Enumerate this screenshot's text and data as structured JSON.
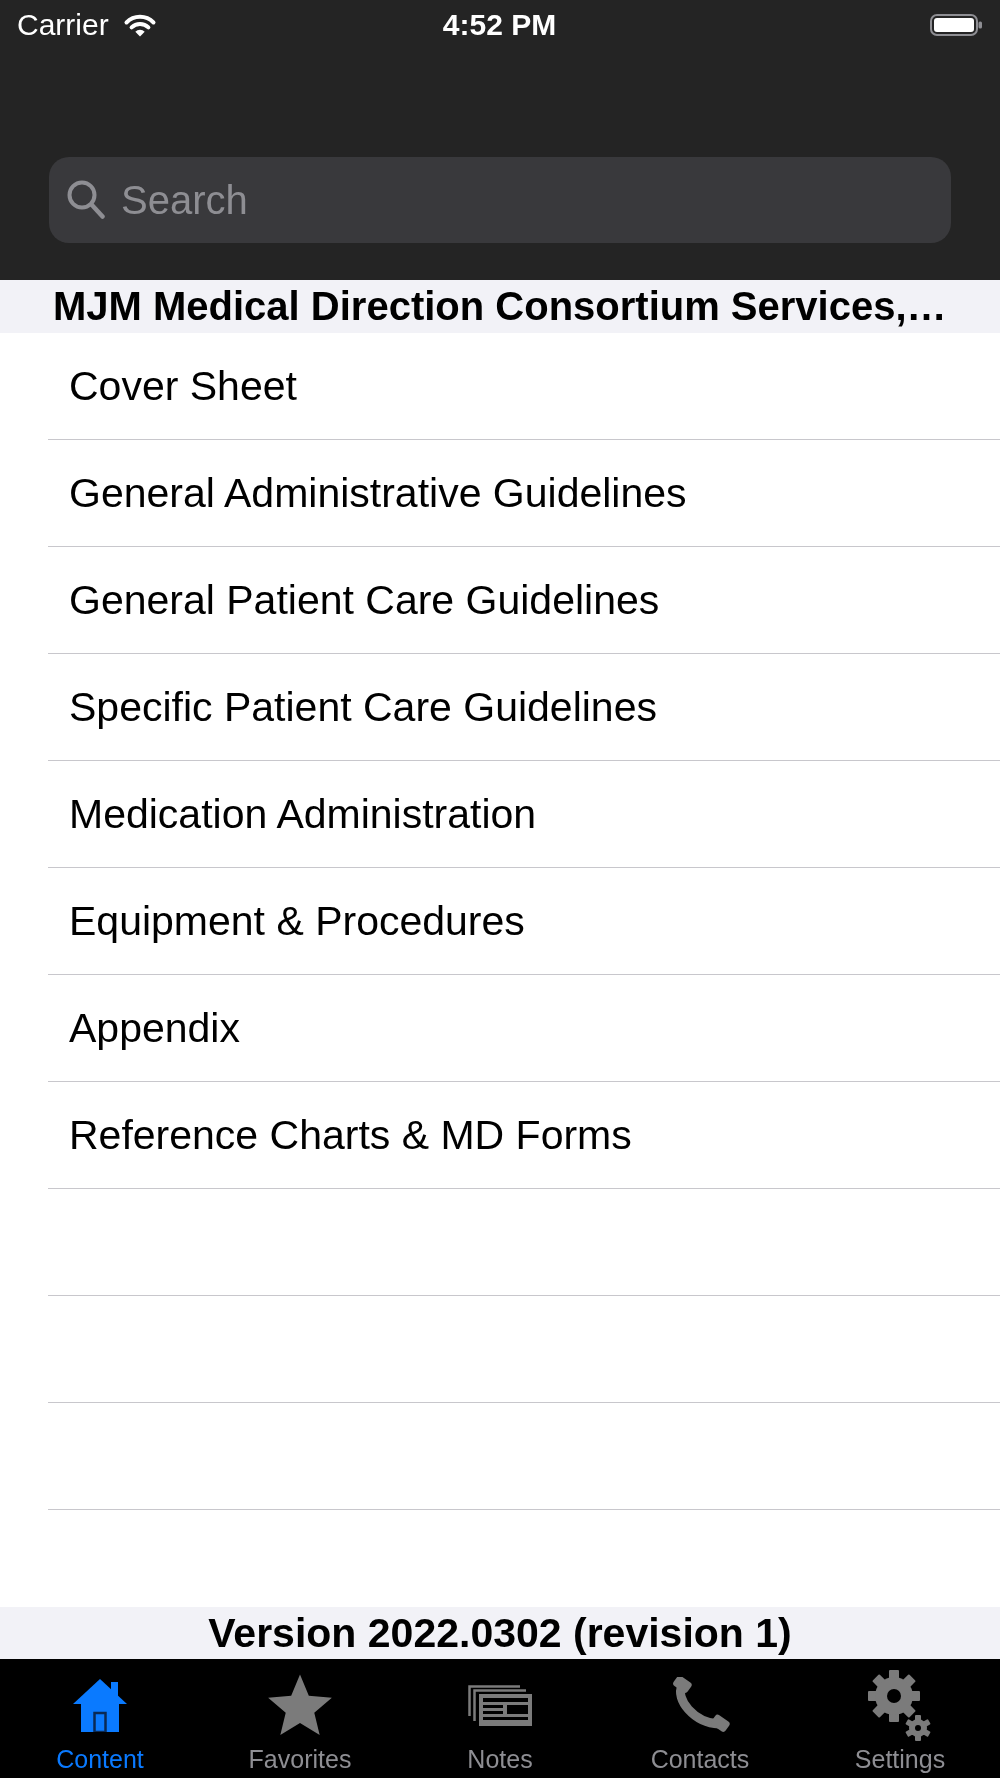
{
  "status_bar": {
    "carrier": "Carrier",
    "time": "4:52 PM"
  },
  "search": {
    "placeholder": "Search"
  },
  "section": {
    "title": "MJM Medical Direction Consortium Services,…"
  },
  "items": [
    {
      "label": "Cover Sheet"
    },
    {
      "label": "General Administrative Guidelines"
    },
    {
      "label": "General Patient Care Guidelines"
    },
    {
      "label": "Specific Patient Care Guidelines"
    },
    {
      "label": "Medication Administration"
    },
    {
      "label": "Equipment & Procedures"
    },
    {
      "label": "Appendix"
    },
    {
      "label": "Reference Charts & MD Forms"
    }
  ],
  "footer": {
    "version": "Version 2022.0302 (revision 1)"
  },
  "tab_bar": {
    "tabs": [
      {
        "label": "Content",
        "selected": true
      },
      {
        "label": "Favorites",
        "selected": false
      },
      {
        "label": "Notes",
        "selected": false
      },
      {
        "label": "Contacts",
        "selected": false
      },
      {
        "label": "Settings",
        "selected": false
      }
    ]
  }
}
